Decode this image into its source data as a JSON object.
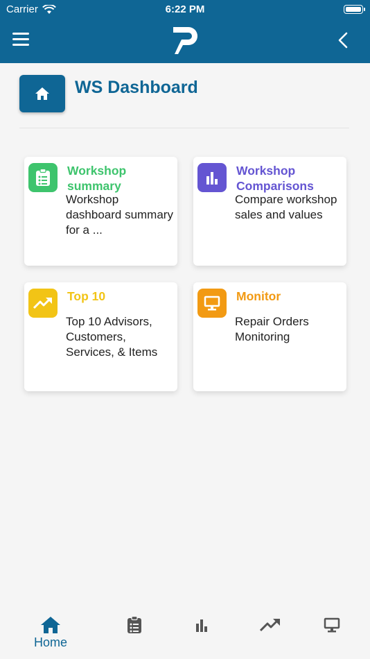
{
  "status_bar": {
    "carrier": "Carrier",
    "time": "6:22 PM"
  },
  "header": {
    "logo_letter": "P"
  },
  "page": {
    "title": "WS Dashboard"
  },
  "cards": [
    {
      "title": "Workshop summary",
      "description": "Workshop dashboard summary for a ...",
      "color": "#3ec46d",
      "icon": "clipboard-list-icon"
    },
    {
      "title": "Workshop Comparisons",
      "description": "Compare workshop sales and values",
      "color": "#6455d2",
      "icon": "bar-chart-icon"
    },
    {
      "title": "Top 10",
      "description": "Top 10 Advisors, Customers, Services, & Items",
      "color": "#f2c416",
      "icon": "trending-up-icon"
    },
    {
      "title": "Monitor",
      "description": "Repair Orders Monitoring",
      "color": "#f29a13",
      "icon": "monitor-icon"
    }
  ],
  "tab_bar": {
    "active_color": "#0f6695",
    "inactive_color": "#555555",
    "tabs": [
      {
        "label": "Home",
        "icon": "home-icon",
        "active": true
      },
      {
        "label": "",
        "icon": "clipboard-list-icon",
        "active": false
      },
      {
        "label": "",
        "icon": "bar-chart-icon",
        "active": false
      },
      {
        "label": "",
        "icon": "trending-up-icon",
        "active": false
      },
      {
        "label": "",
        "icon": "monitor-icon",
        "active": false
      }
    ]
  }
}
